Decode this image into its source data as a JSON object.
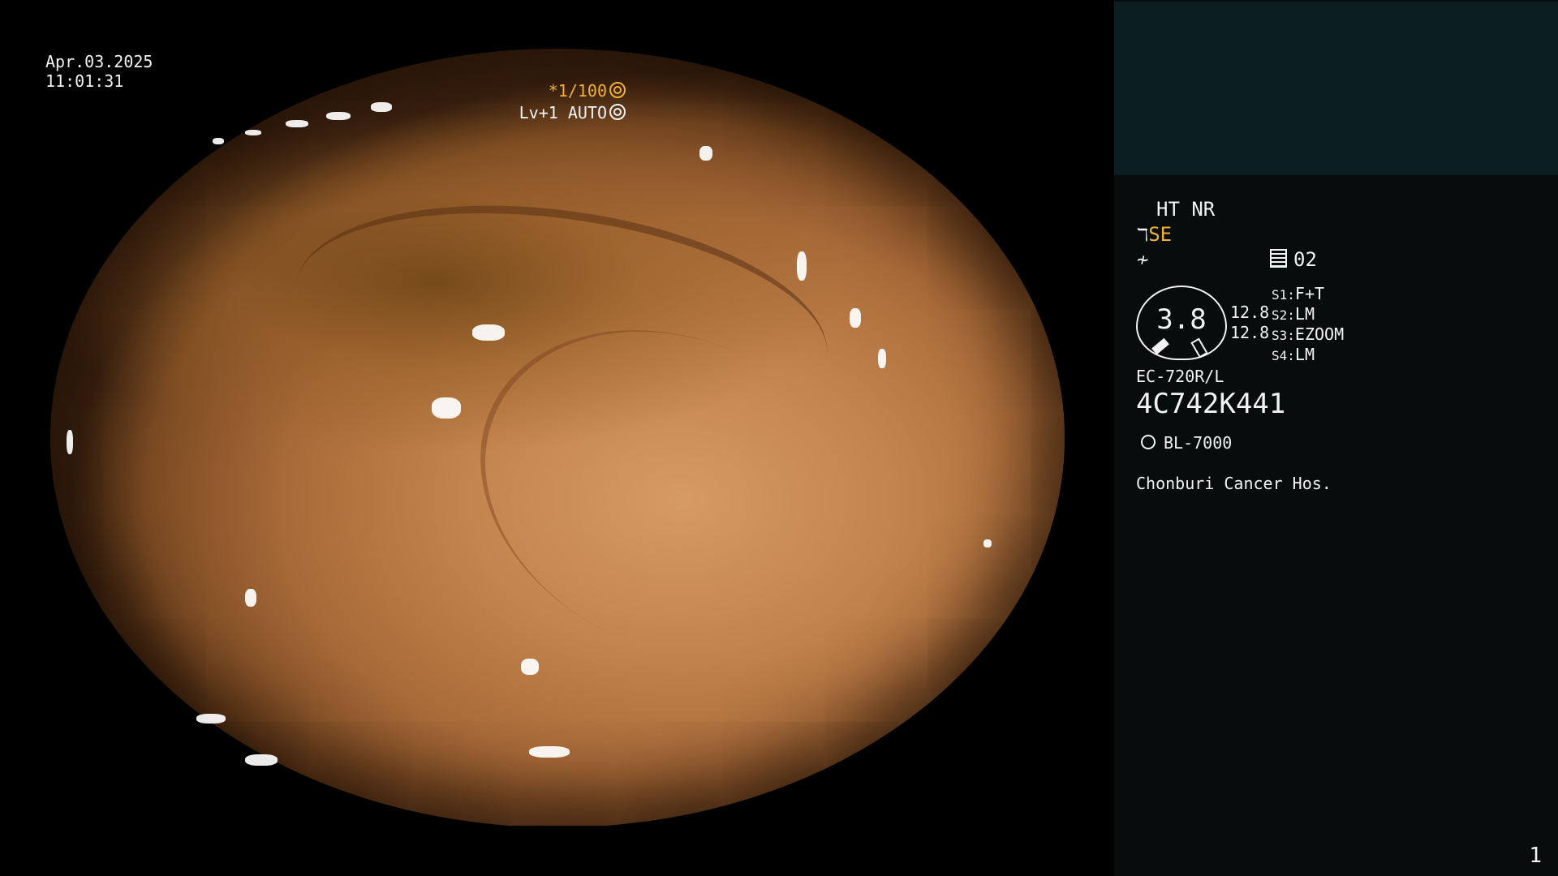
{
  "osd": {
    "date": "Apr.03.2025",
    "time": "11:01:31",
    "shutter": "*1/100",
    "level": "Lv+1 AUTO"
  },
  "panel": {
    "ht_nr": "HT NR",
    "se_label": "SE",
    "video_num": "02",
    "gauge_value": "3.8",
    "value_a": "12.8",
    "value_b": "12.8",
    "slots": [
      {
        "key": "S1:",
        "value": "F+T"
      },
      {
        "key": "S2:",
        "value": "LM"
      },
      {
        "key": "S3:",
        "value": "EZOOM"
      },
      {
        "key": "S4:",
        "value": "LM"
      }
    ],
    "scope_model": "EC-720R/L",
    "serial": "4C742K441",
    "light_source": "BL-7000",
    "hospital": "Chonburi Cancer Hos.",
    "page_number": "1"
  },
  "colors": {
    "accent_orange": "#f0b030",
    "panel_bg": "#070d0d",
    "panel_top_bg": "#0b1f22",
    "text": "#f2f2f2"
  },
  "icons": {
    "shutter": "aperture-icon",
    "level": "auto-iris-icon",
    "se": "scope-tip-icon",
    "fine": "fine-icon",
    "video": "recorder-icon",
    "light": "sun-icon"
  }
}
